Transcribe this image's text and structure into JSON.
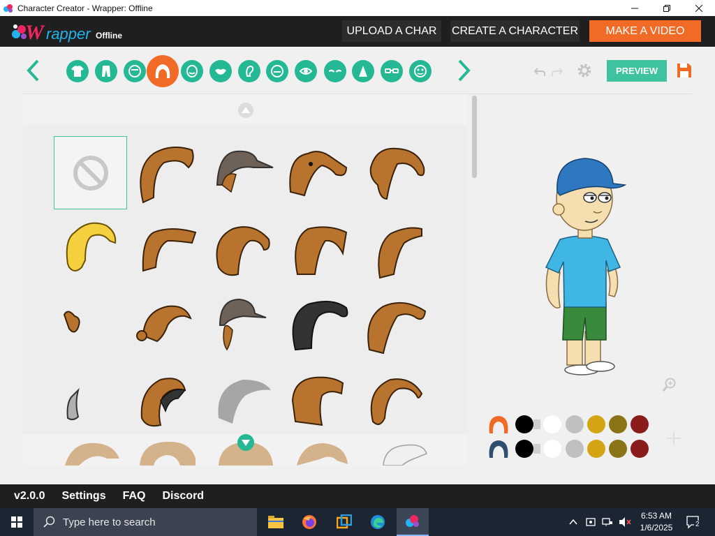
{
  "window": {
    "title": "Character Creator - Wrapper: Offline"
  },
  "header": {
    "logo_w": "W",
    "logo_rapper": "rapper",
    "logo_offline": "Offline",
    "upload_label": "UPLOAD A CHAR",
    "create_label": "CREATE A CHARACTER",
    "video_label": "MAKE A VIDEO"
  },
  "toolbar": {
    "preview_label": "PREVIEW",
    "categories": [
      "upper-body",
      "lower-body",
      "face",
      "hair",
      "mouth-shape",
      "lips",
      "ear",
      "head",
      "eyes",
      "eyebrows",
      "nose",
      "glasses",
      "accessories"
    ],
    "active_category": "hair"
  },
  "colors": {
    "accent": "#24b895",
    "active": "#f26b26",
    "header_bg": "#1f1f1f",
    "hair_brown": "#b8732e",
    "swatches": [
      "#000000",
      "#ffffff",
      "#c0c0c0",
      "#d4a414",
      "#8a7416",
      "#8b1c1c"
    ]
  },
  "footer": {
    "version": "v2.0.0",
    "settings": "Settings",
    "faq": "FAQ",
    "discord": "Discord"
  },
  "taskbar": {
    "search_placeholder": "Type here to search",
    "time": "6:53 AM",
    "date": "1/6/2025",
    "notification_count": "2"
  }
}
